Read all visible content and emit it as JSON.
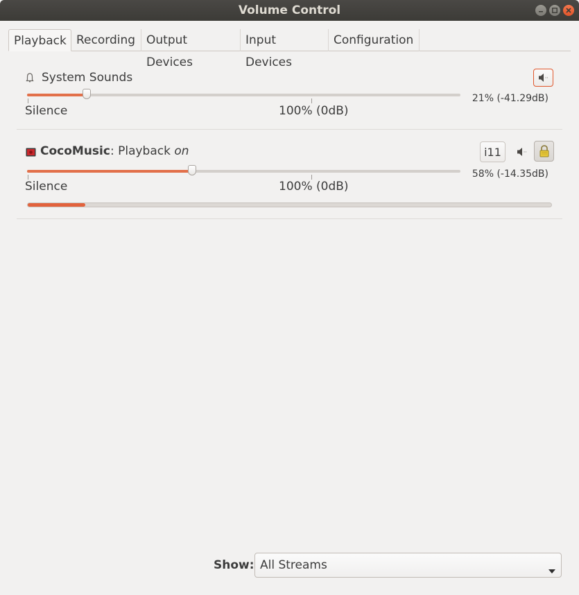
{
  "window": {
    "title": "Volume Control"
  },
  "tabs": [
    {
      "label": "Playback",
      "active": true
    },
    {
      "label": "Recording",
      "active": false
    },
    {
      "label": "Output Devices",
      "active": false
    },
    {
      "label": "Input Devices",
      "active": false
    },
    {
      "label": "Configuration",
      "active": false
    }
  ],
  "streams": [
    {
      "name": "System Sounds",
      "icon": "bell-icon",
      "volume_fraction": 0.21,
      "volume_text": "21% (-41.29dB)",
      "min_label": "Silence",
      "ref_label": "100% (0dB)",
      "mute_icon": "speaker-icon",
      "muted": false
    },
    {
      "app": "CocoMusic",
      "separator": ": ",
      "detail": "Playback ",
      "state": "on",
      "icon": "app-icon",
      "volume_fraction": 0.58,
      "volume_text": "58% (-14.35dB)",
      "min_label": "Silence",
      "ref_label": "100% (0dB)",
      "device_label": "i11",
      "mute_icon": "speaker-icon",
      "lock_icon": "lock-icon",
      "locked": true,
      "peak_level": 0.11
    }
  ],
  "footer": {
    "show_label": "Show:",
    "show_value": "All Streams"
  },
  "colors": {
    "accent": "#e2704a",
    "close_button": "#e0552a",
    "titlebar": "#3c3b37",
    "background": "#f2f1f0"
  }
}
